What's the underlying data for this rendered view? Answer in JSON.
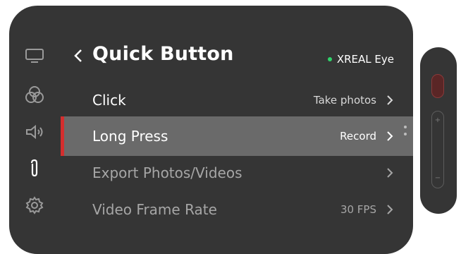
{
  "header": {
    "title": "Quick Button",
    "device_name": "XREAL Eye",
    "status_color": "#2fd36a"
  },
  "sidebar": {
    "items": [
      {
        "icon": "display-icon"
      },
      {
        "icon": "color-circles-icon"
      },
      {
        "icon": "speaker-icon"
      },
      {
        "icon": "paperclip-icon",
        "selected": true
      },
      {
        "icon": "gear-icon"
      }
    ]
  },
  "rows": [
    {
      "label": "Click",
      "value": "Take photos"
    },
    {
      "label": "Long Press",
      "value": "Record",
      "active": true
    },
    {
      "label": "Export Photos/Videos",
      "value": ""
    },
    {
      "label": "Video Frame Rate",
      "value": "30 FPS"
    }
  ],
  "controller": {
    "plus": "+",
    "minus": "−"
  },
  "colors": {
    "panel": "#353535",
    "active_row": "#6a6a6a",
    "accent": "#d42e2e"
  }
}
